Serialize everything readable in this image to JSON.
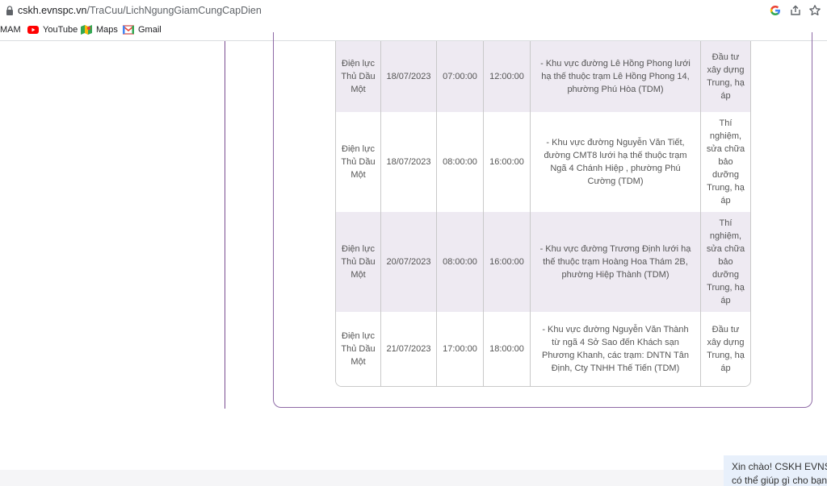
{
  "browser": {
    "url_host": "cskh.evnspc.vn",
    "url_path": "/TraCuu/LichNgungGiamCungCapDien",
    "bookmarks": [
      {
        "label": "MAM",
        "icon": "none"
      },
      {
        "label": "YouTube",
        "icon": "youtube-icon"
      },
      {
        "label": "Maps",
        "icon": "maps-icon"
      },
      {
        "label": "Gmail",
        "icon": "gmail-icon"
      }
    ],
    "toolbar_icons": [
      "google-icon",
      "share-icon",
      "bookmark-star-icon"
    ]
  },
  "table": {
    "rows": [
      {
        "unit": "Điện lực Thủ Dầu Một",
        "date": "18/07/2023",
        "start": "07:00:00",
        "end": "12:00:00",
        "area": "- Khu vực đường Lê Hồng Phong lưới hạ thế thuộc trạm Lê Hồng Phong 14, phường Phú Hòa (TDM)",
        "reason": "Đầu tư xây dựng Trung, hạ áp"
      },
      {
        "unit": "Điện lực Thủ Dầu Một",
        "date": "18/07/2023",
        "start": "08:00:00",
        "end": "16:00:00",
        "area": "- Khu vực đường Nguyễn Văn Tiết, đường CMT8 lưới hạ thế thuộc trạm Ngã 4 Chánh Hiệp , phường Phú Cường (TDM)",
        "reason": "Thí nghiệm, sửa chữa bảo dưỡng Trung, hạ áp"
      },
      {
        "unit": "Điện lực Thủ Dầu Một",
        "date": "20/07/2023",
        "start": "08:00:00",
        "end": "16:00:00",
        "area": "- Khu vực đường Trương Định lưới hạ thế thuộc trạm Hoàng Hoa Thám 2B, phường Hiệp Thành (TDM)",
        "reason": "Thí nghiệm, sửa chữa bảo dưỡng Trung, hạ áp"
      },
      {
        "unit": "Điện lực Thủ Dầu Một",
        "date": "21/07/2023",
        "start": "17:00:00",
        "end": "18:00:00",
        "area": "- Khu vực đường Nguyễn Văn Thành từ ngã 4 Sở Sao đến Khách sạn Phương Khanh, các trạm: DNTN Tân Định, Cty TNHH Thế Tiến (TDM)",
        "reason": "Đầu tư xây dựng Trung, hạ áp"
      }
    ]
  },
  "chat": {
    "line1": "Xin chào! CSKH EVNSPC",
    "line2": "có thể giúp gì cho bạn?"
  },
  "colors": {
    "row_shaded": "#eeeaf2",
    "row_plain": "#ffffff",
    "accent": "#7b4d92"
  }
}
